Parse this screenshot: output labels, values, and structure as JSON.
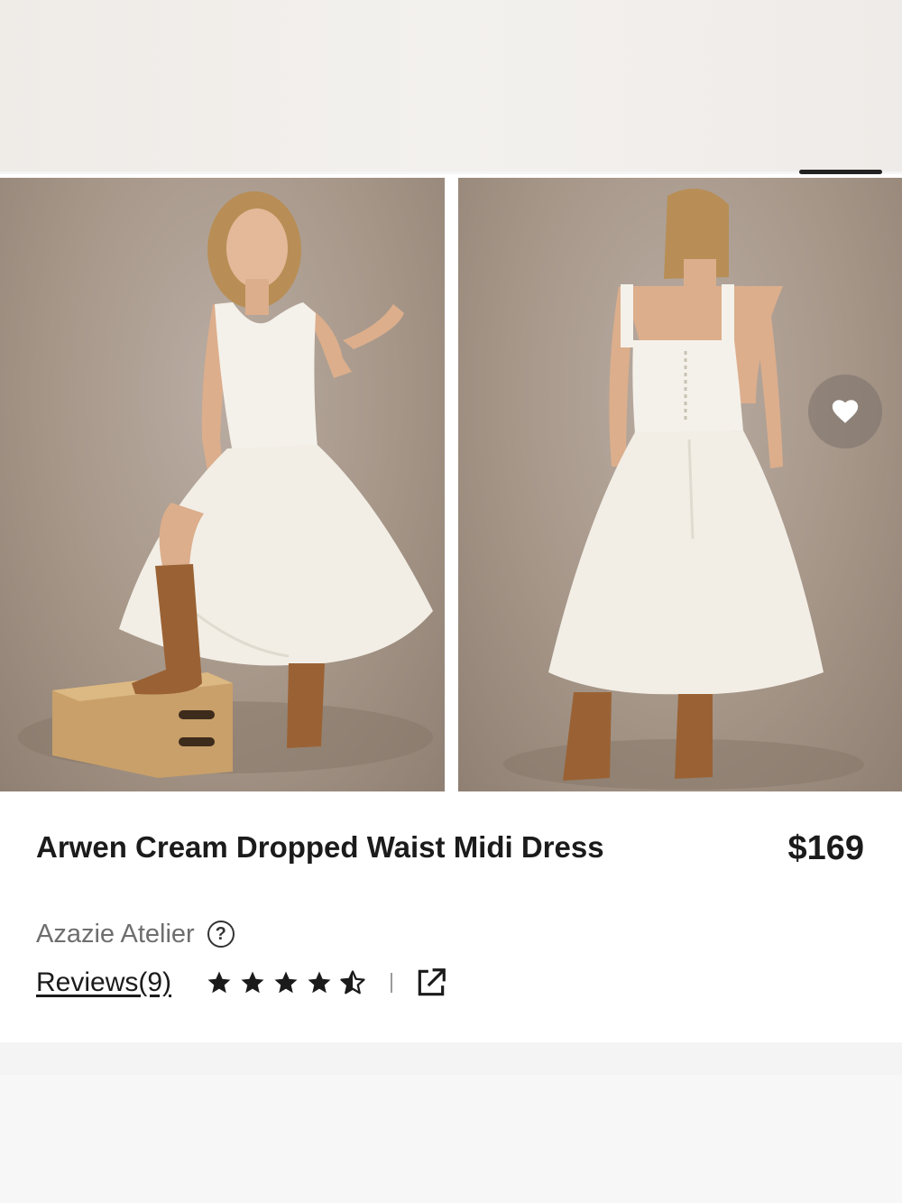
{
  "product": {
    "title": "Arwen Cream Dropped Waist Midi Dress",
    "price": "$169",
    "brand": "Azazie Atelier",
    "help_glyph": "?",
    "reviews_label": "Reviews(9)",
    "rating": 4.5,
    "rating_max": 5
  },
  "gallery": {
    "images": [
      {
        "icon": "model-front-view-image"
      },
      {
        "icon": "model-back-view-image"
      }
    ]
  },
  "icons": {
    "wishlist": "heart-icon",
    "help": "question-circle-icon",
    "share": "external-link-icon",
    "star": "star-icon"
  },
  "colors": {
    "text": "#1b1b1b",
    "muted": "#6e6e6e",
    "photo_bg": "#a69688",
    "dress": "#f4f1ea",
    "boots": "#9a6234"
  }
}
